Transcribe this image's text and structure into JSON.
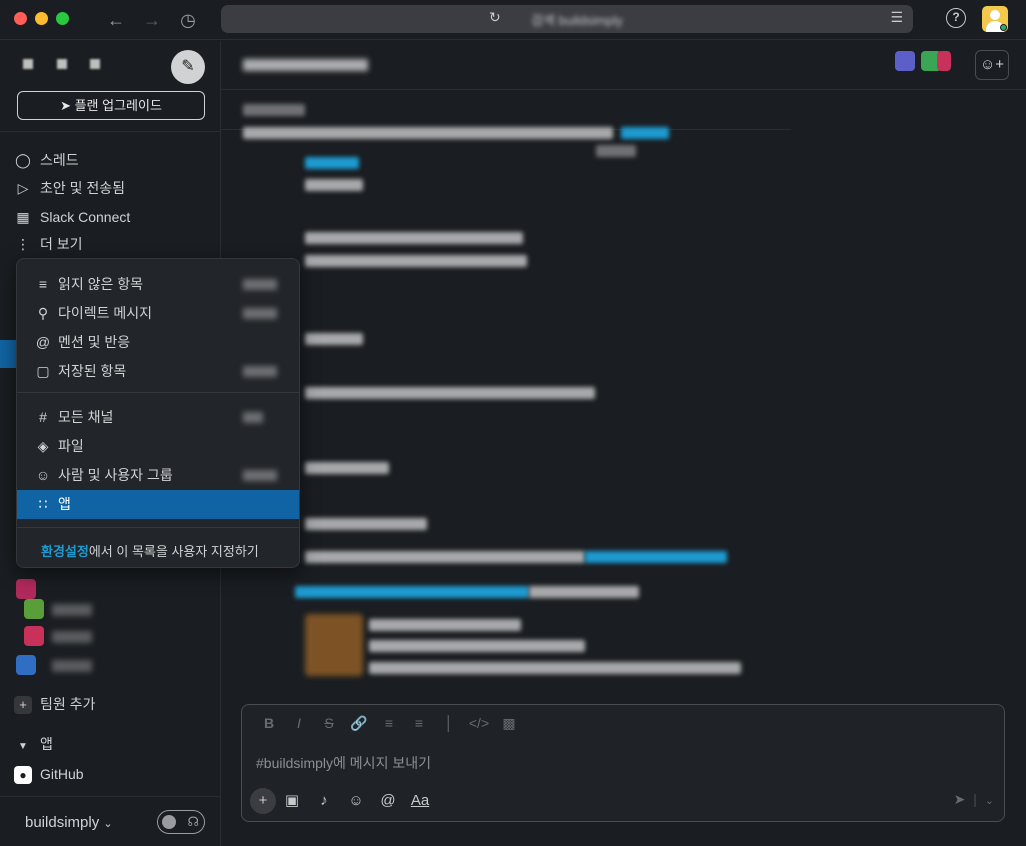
{
  "titlebar": {
    "back_icon": "arrow-left-icon",
    "forward_icon": "arrow-right-icon",
    "history_icon": "clock-icon",
    "search_text": "검색 buildsimply",
    "help_icon": "question-circle-icon"
  },
  "sidebar": {
    "upgrade_label": "플랜 업그레이드",
    "nav": [
      {
        "label": "스레드",
        "icon": "threads-icon"
      },
      {
        "label": "초안 및 전송됨",
        "icon": "send-icon"
      },
      {
        "label": "Slack Connect",
        "icon": "building-icon"
      },
      {
        "label": "더 보기",
        "icon": "more-vertical-icon"
      }
    ],
    "add_member_label": "팀원 추가",
    "apps_section_label": "앱",
    "github_label": "GitHub",
    "workspace_name": "buildsimply"
  },
  "menu": {
    "items": [
      {
        "label": "읽지 않은 항목",
        "icon": "unread-icon"
      },
      {
        "label": "다이렉트 메시지",
        "icon": "dm-icon"
      },
      {
        "label": "멘션 및 반응",
        "icon": "at-icon"
      },
      {
        "label": "저장된 항목",
        "icon": "bookmark-icon"
      },
      {
        "label": "모든 채널",
        "icon": "channels-icon"
      },
      {
        "label": "파일",
        "icon": "layers-icon"
      },
      {
        "label": "사람 및 사용자 그룹",
        "icon": "people-icon"
      },
      {
        "label": "앱",
        "icon": "apps-grid-icon",
        "active": true
      }
    ],
    "footer_link": "환경설정",
    "footer_text": "에서 이 목록을 사용자 지정하기"
  },
  "composer": {
    "placeholder": "#buildsimply에 메시지 보내기",
    "aa_label": "Aa"
  },
  "colors": {
    "accent": "#1164a3",
    "link": "#1d9bd1",
    "background": "#1a1d21"
  }
}
